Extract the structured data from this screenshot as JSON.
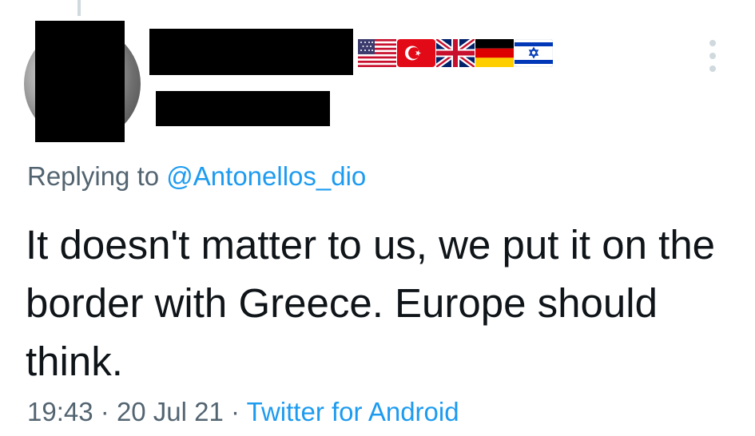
{
  "reply": {
    "prefix": "Replying to",
    "mention": "@Antonellos_dio"
  },
  "tweet": {
    "text": "It doesn't matter to us, we put it on the border with Greece. Europe should think."
  },
  "meta": {
    "time": "19:43",
    "separator": "·",
    "date": "20 Jul 21",
    "source": "Twitter for Android"
  },
  "flags": [
    "united-states",
    "turkey",
    "united-kingdom",
    "germany",
    "israel"
  ],
  "colors": {
    "text": "#0f1419",
    "secondary": "#536471",
    "link": "#1d9bf0",
    "thread_line": "#cfd9de"
  }
}
